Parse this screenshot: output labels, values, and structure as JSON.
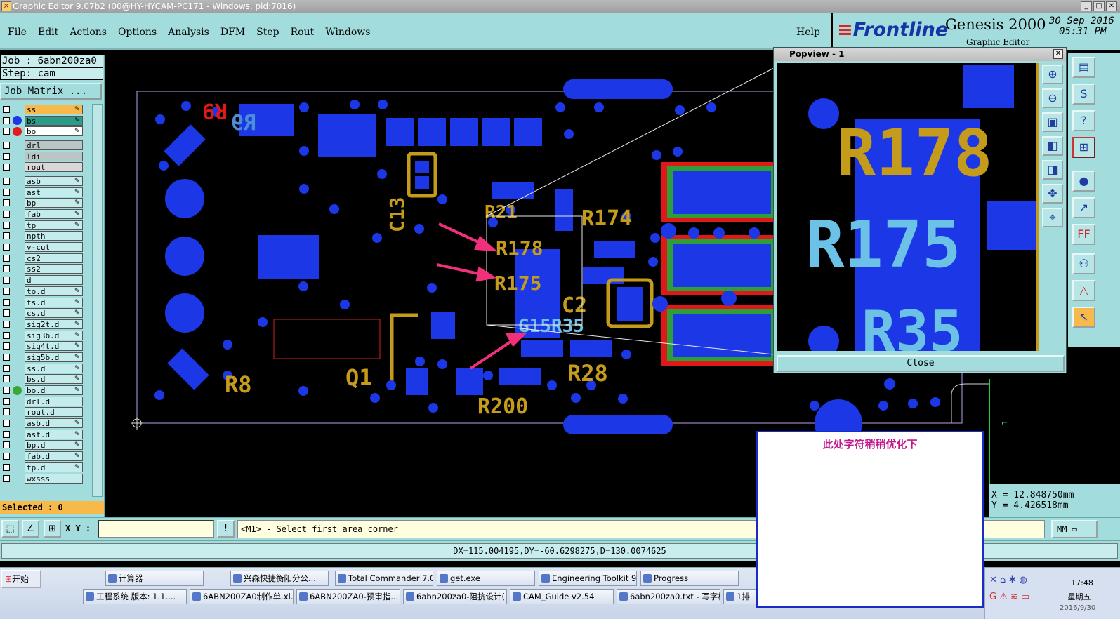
{
  "window": {
    "title": "Graphic Editor 9.07b2 (00@HY-HYCAM-PC171 - Windows, pid:7016)"
  },
  "menu": {
    "items": [
      "File",
      "Edit",
      "Actions",
      "Options",
      "Analysis",
      "DFM",
      "Step",
      "Rout",
      "Windows"
    ],
    "help": "Help"
  },
  "brand": {
    "logo": "Frontline",
    "product": "Genesis 2000",
    "subtitle": "Graphic Editor",
    "date": "30 Sep 2016",
    "time": "05:31 PM"
  },
  "job": {
    "job_line": "Job : 6abn200za0",
    "step_line": "Step: cam",
    "matrix_button": "Job Matrix ..."
  },
  "layers": [
    {
      "name": "ss",
      "color": "#f6b94a",
      "dot": "",
      "pen": true
    },
    {
      "name": "bs",
      "color": "#2b9c8a",
      "dot": "#1c37e6",
      "pen": true
    },
    {
      "name": "bo",
      "color": "#ffffff",
      "dot": "#e31b1b",
      "pen": true
    },
    {
      "name": "",
      "color": "",
      "dot": "",
      "pen": false
    },
    {
      "name": "drl",
      "color": "#b9c6c6",
      "dot": "",
      "pen": false
    },
    {
      "name": "ldi",
      "color": "#b9c6c6",
      "dot": "",
      "pen": false
    },
    {
      "name": "rout",
      "color": "#d8d8d8",
      "dot": "",
      "pen": false
    },
    {
      "name": "",
      "color": "",
      "dot": "",
      "pen": false
    },
    {
      "name": "asb",
      "color": "#c5ecec",
      "dot": "",
      "pen": true
    },
    {
      "name": "ast",
      "color": "#c5ecec",
      "dot": "",
      "pen": true
    },
    {
      "name": "bp",
      "color": "#c5ecec",
      "dot": "",
      "pen": true
    },
    {
      "name": "fab",
      "color": "#c5ecec",
      "dot": "",
      "pen": true
    },
    {
      "name": "tp",
      "color": "#c5ecec",
      "dot": "",
      "pen": true
    },
    {
      "name": "npth",
      "color": "#c5ecec",
      "dot": "",
      "pen": false
    },
    {
      "name": "v-cut",
      "color": "#c5ecec",
      "dot": "",
      "pen": false
    },
    {
      "name": "cs2",
      "color": "#c5ecec",
      "dot": "",
      "pen": false
    },
    {
      "name": "ss2",
      "color": "#c5ecec",
      "dot": "",
      "pen": false
    },
    {
      "name": "d",
      "color": "#c5ecec",
      "dot": "",
      "pen": false
    },
    {
      "name": "to.d",
      "color": "#c5ecec",
      "dot": "",
      "pen": true
    },
    {
      "name": "ts.d",
      "color": "#c5ecec",
      "dot": "",
      "pen": true
    },
    {
      "name": "cs.d",
      "color": "#c5ecec",
      "dot": "",
      "pen": true
    },
    {
      "name": "sig2t.d",
      "color": "#c5ecec",
      "dot": "",
      "pen": true
    },
    {
      "name": "sig3b.d",
      "color": "#c5ecec",
      "dot": "",
      "pen": true
    },
    {
      "name": "sig4t.d",
      "color": "#c5ecec",
      "dot": "",
      "pen": true
    },
    {
      "name": "sig5b.d",
      "color": "#c5ecec",
      "dot": "",
      "pen": true
    },
    {
      "name": "ss.d",
      "color": "#c5ecec",
      "dot": "",
      "pen": true
    },
    {
      "name": "bs.d",
      "color": "#c5ecec",
      "dot": "",
      "pen": true
    },
    {
      "name": "bo.d",
      "color": "#c5ecec",
      "dot": "#3aa832",
      "pen": true
    },
    {
      "name": "drl.d",
      "color": "#c5ecec",
      "dot": "",
      "pen": false
    },
    {
      "name": "rout.d",
      "color": "#c5ecec",
      "dot": "",
      "pen": false
    },
    {
      "name": "asb.d",
      "color": "#c5ecec",
      "dot": "",
      "pen": true
    },
    {
      "name": "ast.d",
      "color": "#c5ecec",
      "dot": "",
      "pen": true
    },
    {
      "name": "bp.d",
      "color": "#c5ecec",
      "dot": "",
      "pen": true
    },
    {
      "name": "fab.d",
      "color": "#c5ecec",
      "dot": "",
      "pen": true
    },
    {
      "name": "tp.d",
      "color": "#c5ecec",
      "dot": "",
      "pen": true
    },
    {
      "name": "wxsss",
      "color": "#c5ecec",
      "dot": "",
      "pen": false
    }
  ],
  "selected": "Selected : 0",
  "canvas_labels": [
    "R9",
    "R9",
    "C13",
    "R21",
    "R174",
    "R178",
    "R175",
    "C2",
    "G15R35",
    "Q1",
    "R8",
    "R28",
    "R200"
  ],
  "popview": {
    "title": "Popview - 1",
    "close_label": "Close",
    "labels": [
      "R178",
      "R175",
      "R35"
    ]
  },
  "coords": {
    "x": "X = 12.848750mm",
    "y": "Y = 4.426518mm"
  },
  "command": {
    "xy_label": "X Y :",
    "prompt": "<M1> - Select first area corner",
    "unit": "MM"
  },
  "status": "DX=115.004195,DY=-60.6298275,D=130.0074625",
  "annotation": "此处字符稍稍优化下",
  "taskbar": {
    "start": "开始",
    "row1": [
      "计算器",
      "兴森快捷衡阳分公...",
      "Total Commander 7.0 ...",
      "get.exe",
      "Engineering Toolkit 9....",
      "Progress"
    ],
    "row2": [
      "工程系统  版本: 1.1....",
      "6ABN200ZA0制作单.xl...",
      "6ABN200ZA0-预审指...",
      "6abn200za0-阻抗设计(...",
      "CAM_Guide v2.54",
      "6abn200za0.txt - 写字板",
      "1排"
    ],
    "time": "17:48",
    "day": "星期五",
    "date": "2016/9/30"
  }
}
